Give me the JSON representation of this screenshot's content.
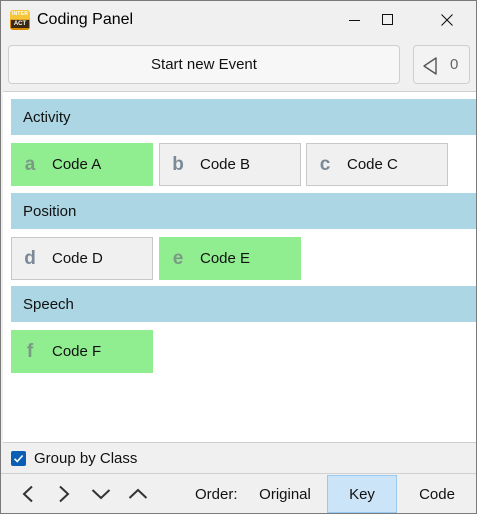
{
  "window": {
    "title": "Coding Panel",
    "app_icon_top": "INTER",
    "app_icon_bottom": "ACT"
  },
  "toolbar": {
    "start_label": "Start new Event",
    "undo_count": "0"
  },
  "groups": [
    {
      "name": "Activity",
      "codes": [
        {
          "key": "a",
          "label": "Code A",
          "active": true
        },
        {
          "key": "b",
          "label": "Code B",
          "active": false
        },
        {
          "key": "c",
          "label": "Code C",
          "active": false
        }
      ]
    },
    {
      "name": "Position",
      "codes": [
        {
          "key": "d",
          "label": "Code D",
          "active": false
        },
        {
          "key": "e",
          "label": "Code E",
          "active": true
        }
      ]
    },
    {
      "name": "Speech",
      "codes": [
        {
          "key": "f",
          "label": "Code F",
          "active": true
        }
      ]
    }
  ],
  "group_by_class": {
    "label": "Group by Class",
    "checked": true
  },
  "order": {
    "label": "Order:",
    "options": [
      "Original",
      "Key",
      "Code"
    ],
    "selected": "Key"
  },
  "colors": {
    "header_bg": "#acd6e4",
    "active_code": "#90ee90",
    "inactive_code": "#f0f0f0",
    "selected_order": "#cce4f7",
    "checkbox": "#0a5fb4"
  }
}
